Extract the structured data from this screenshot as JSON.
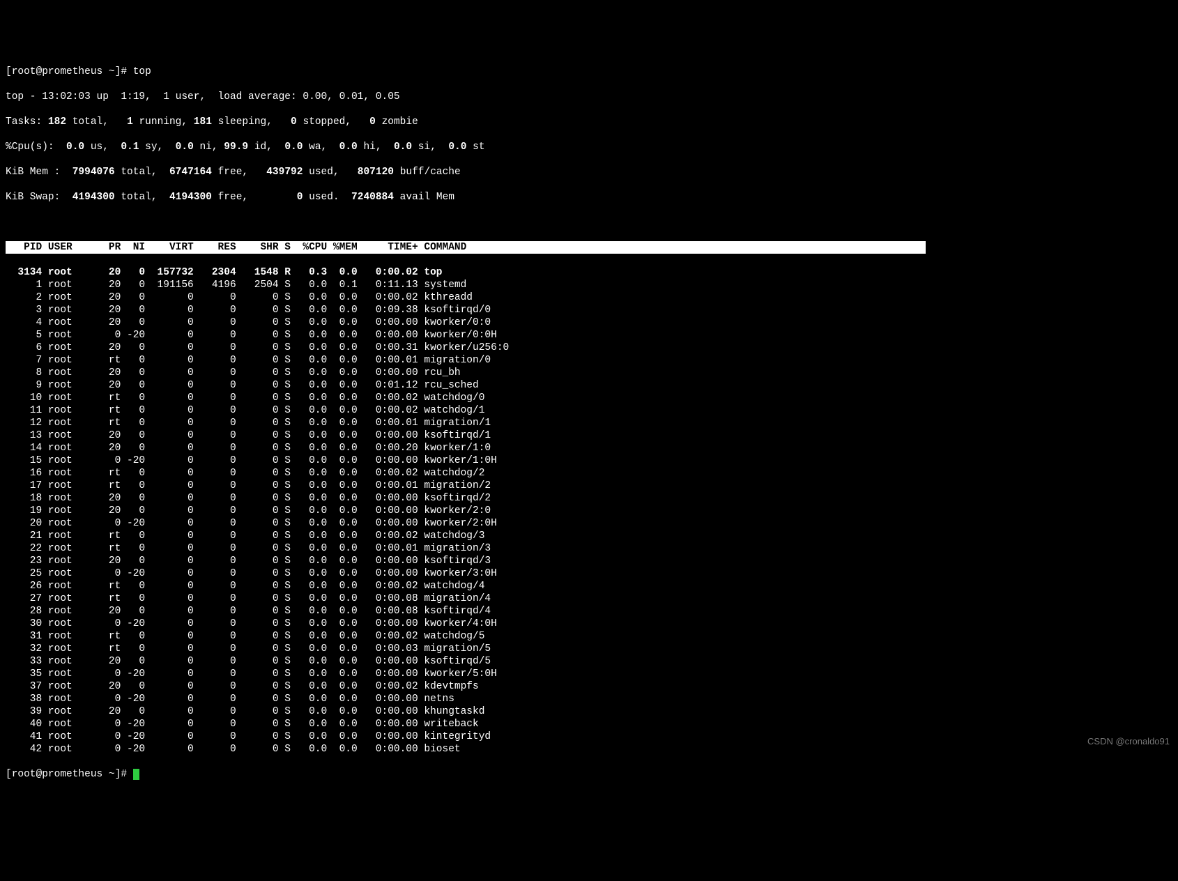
{
  "prompt1": "[root@prometheus ~]# ",
  "command": "top",
  "summary": {
    "line1": "top - 13:02:03 up  1:19,  1 user,  load average: 0.00, 0.01, 0.05",
    "line2_pre": "Tasks: ",
    "line2_total": "182 ",
    "line2_text1": "total,   ",
    "line2_running": "1 ",
    "line2_text2": "running, ",
    "line2_sleeping": "181 ",
    "line2_text3": "sleeping,   ",
    "line2_stopped": "0 ",
    "line2_text4": "stopped,   ",
    "line2_zombie": "0 ",
    "line2_text5": "zombie",
    "line3": "%Cpu(s):  0.0 us,  0.1 sy,  0.0 ni, 99.9 id,  0.0 wa,  0.0 hi,  0.0 si,  0.0 st",
    "line3_pre": "%Cpu(s):  ",
    "cpu_us": "0.0 ",
    "cpu_us_l": "us,  ",
    "cpu_sy": "0.1 ",
    "cpu_sy_l": "sy,  ",
    "cpu_ni": "0.0 ",
    "cpu_ni_l": "ni, ",
    "cpu_id": "99.9 ",
    "cpu_id_l": "id,  ",
    "cpu_wa": "0.0 ",
    "cpu_wa_l": "wa,  ",
    "cpu_hi": "0.0 ",
    "cpu_hi_l": "hi,  ",
    "cpu_si": "0.0 ",
    "cpu_si_l": "si,  ",
    "cpu_st": "0.0 ",
    "cpu_st_l": "st",
    "line4_pre": "KiB Mem : ",
    "mem_total": " 7994076 ",
    "mem_total_l": "total,  ",
    "mem_free": "6747164 ",
    "mem_free_l": "free,   ",
    "mem_used": "439792 ",
    "mem_used_l": "used,   ",
    "mem_buff": "807120 ",
    "mem_buff_l": "buff/cache",
    "line5_pre": "KiB Swap: ",
    "swap_total": " 4194300 ",
    "swap_total_l": "total,  ",
    "swap_free": "4194300 ",
    "swap_free_l": "free,        ",
    "swap_used": "0 ",
    "swap_used_l": "used.  ",
    "swap_avail": "7240884 ",
    "swap_avail_l": "avail Mem"
  },
  "header": "   PID USER      PR  NI    VIRT    RES    SHR S  %CPU %MEM     TIME+ COMMAND",
  "rows": [
    {
      "pid": "3134",
      "user": "root",
      "pr": "20",
      "ni": "0",
      "virt": "157732",
      "res": "2304",
      "shr": "1548",
      "s": "R",
      "cpu": "0.3",
      "mem": "0.0",
      "time": "0:00.02",
      "cmd": "top",
      "bold": true
    },
    {
      "pid": "1",
      "user": "root",
      "pr": "20",
      "ni": "0",
      "virt": "191156",
      "res": "4196",
      "shr": "2504",
      "s": "S",
      "cpu": "0.0",
      "mem": "0.1",
      "time": "0:11.13",
      "cmd": "systemd"
    },
    {
      "pid": "2",
      "user": "root",
      "pr": "20",
      "ni": "0",
      "virt": "0",
      "res": "0",
      "shr": "0",
      "s": "S",
      "cpu": "0.0",
      "mem": "0.0",
      "time": "0:00.02",
      "cmd": "kthreadd"
    },
    {
      "pid": "3",
      "user": "root",
      "pr": "20",
      "ni": "0",
      "virt": "0",
      "res": "0",
      "shr": "0",
      "s": "S",
      "cpu": "0.0",
      "mem": "0.0",
      "time": "0:09.38",
      "cmd": "ksoftirqd/0"
    },
    {
      "pid": "4",
      "user": "root",
      "pr": "20",
      "ni": "0",
      "virt": "0",
      "res": "0",
      "shr": "0",
      "s": "S",
      "cpu": "0.0",
      "mem": "0.0",
      "time": "0:00.00",
      "cmd": "kworker/0:0"
    },
    {
      "pid": "5",
      "user": "root",
      "pr": "0",
      "ni": "-20",
      "virt": "0",
      "res": "0",
      "shr": "0",
      "s": "S",
      "cpu": "0.0",
      "mem": "0.0",
      "time": "0:00.00",
      "cmd": "kworker/0:0H"
    },
    {
      "pid": "6",
      "user": "root",
      "pr": "20",
      "ni": "0",
      "virt": "0",
      "res": "0",
      "shr": "0",
      "s": "S",
      "cpu": "0.0",
      "mem": "0.0",
      "time": "0:00.31",
      "cmd": "kworker/u256:0"
    },
    {
      "pid": "7",
      "user": "root",
      "pr": "rt",
      "ni": "0",
      "virt": "0",
      "res": "0",
      "shr": "0",
      "s": "S",
      "cpu": "0.0",
      "mem": "0.0",
      "time": "0:00.01",
      "cmd": "migration/0"
    },
    {
      "pid": "8",
      "user": "root",
      "pr": "20",
      "ni": "0",
      "virt": "0",
      "res": "0",
      "shr": "0",
      "s": "S",
      "cpu": "0.0",
      "mem": "0.0",
      "time": "0:00.00",
      "cmd": "rcu_bh"
    },
    {
      "pid": "9",
      "user": "root",
      "pr": "20",
      "ni": "0",
      "virt": "0",
      "res": "0",
      "shr": "0",
      "s": "S",
      "cpu": "0.0",
      "mem": "0.0",
      "time": "0:01.12",
      "cmd": "rcu_sched"
    },
    {
      "pid": "10",
      "user": "root",
      "pr": "rt",
      "ni": "0",
      "virt": "0",
      "res": "0",
      "shr": "0",
      "s": "S",
      "cpu": "0.0",
      "mem": "0.0",
      "time": "0:00.02",
      "cmd": "watchdog/0"
    },
    {
      "pid": "11",
      "user": "root",
      "pr": "rt",
      "ni": "0",
      "virt": "0",
      "res": "0",
      "shr": "0",
      "s": "S",
      "cpu": "0.0",
      "mem": "0.0",
      "time": "0:00.02",
      "cmd": "watchdog/1"
    },
    {
      "pid": "12",
      "user": "root",
      "pr": "rt",
      "ni": "0",
      "virt": "0",
      "res": "0",
      "shr": "0",
      "s": "S",
      "cpu": "0.0",
      "mem": "0.0",
      "time": "0:00.01",
      "cmd": "migration/1"
    },
    {
      "pid": "13",
      "user": "root",
      "pr": "20",
      "ni": "0",
      "virt": "0",
      "res": "0",
      "shr": "0",
      "s": "S",
      "cpu": "0.0",
      "mem": "0.0",
      "time": "0:00.00",
      "cmd": "ksoftirqd/1"
    },
    {
      "pid": "14",
      "user": "root",
      "pr": "20",
      "ni": "0",
      "virt": "0",
      "res": "0",
      "shr": "0",
      "s": "S",
      "cpu": "0.0",
      "mem": "0.0",
      "time": "0:00.20",
      "cmd": "kworker/1:0"
    },
    {
      "pid": "15",
      "user": "root",
      "pr": "0",
      "ni": "-20",
      "virt": "0",
      "res": "0",
      "shr": "0",
      "s": "S",
      "cpu": "0.0",
      "mem": "0.0",
      "time": "0:00.00",
      "cmd": "kworker/1:0H"
    },
    {
      "pid": "16",
      "user": "root",
      "pr": "rt",
      "ni": "0",
      "virt": "0",
      "res": "0",
      "shr": "0",
      "s": "S",
      "cpu": "0.0",
      "mem": "0.0",
      "time": "0:00.02",
      "cmd": "watchdog/2"
    },
    {
      "pid": "17",
      "user": "root",
      "pr": "rt",
      "ni": "0",
      "virt": "0",
      "res": "0",
      "shr": "0",
      "s": "S",
      "cpu": "0.0",
      "mem": "0.0",
      "time": "0:00.01",
      "cmd": "migration/2"
    },
    {
      "pid": "18",
      "user": "root",
      "pr": "20",
      "ni": "0",
      "virt": "0",
      "res": "0",
      "shr": "0",
      "s": "S",
      "cpu": "0.0",
      "mem": "0.0",
      "time": "0:00.00",
      "cmd": "ksoftirqd/2"
    },
    {
      "pid": "19",
      "user": "root",
      "pr": "20",
      "ni": "0",
      "virt": "0",
      "res": "0",
      "shr": "0",
      "s": "S",
      "cpu": "0.0",
      "mem": "0.0",
      "time": "0:00.00",
      "cmd": "kworker/2:0"
    },
    {
      "pid": "20",
      "user": "root",
      "pr": "0",
      "ni": "-20",
      "virt": "0",
      "res": "0",
      "shr": "0",
      "s": "S",
      "cpu": "0.0",
      "mem": "0.0",
      "time": "0:00.00",
      "cmd": "kworker/2:0H"
    },
    {
      "pid": "21",
      "user": "root",
      "pr": "rt",
      "ni": "0",
      "virt": "0",
      "res": "0",
      "shr": "0",
      "s": "S",
      "cpu": "0.0",
      "mem": "0.0",
      "time": "0:00.02",
      "cmd": "watchdog/3"
    },
    {
      "pid": "22",
      "user": "root",
      "pr": "rt",
      "ni": "0",
      "virt": "0",
      "res": "0",
      "shr": "0",
      "s": "S",
      "cpu": "0.0",
      "mem": "0.0",
      "time": "0:00.01",
      "cmd": "migration/3"
    },
    {
      "pid": "23",
      "user": "root",
      "pr": "20",
      "ni": "0",
      "virt": "0",
      "res": "0",
      "shr": "0",
      "s": "S",
      "cpu": "0.0",
      "mem": "0.0",
      "time": "0:00.00",
      "cmd": "ksoftirqd/3"
    },
    {
      "pid": "25",
      "user": "root",
      "pr": "0",
      "ni": "-20",
      "virt": "0",
      "res": "0",
      "shr": "0",
      "s": "S",
      "cpu": "0.0",
      "mem": "0.0",
      "time": "0:00.00",
      "cmd": "kworker/3:0H"
    },
    {
      "pid": "26",
      "user": "root",
      "pr": "rt",
      "ni": "0",
      "virt": "0",
      "res": "0",
      "shr": "0",
      "s": "S",
      "cpu": "0.0",
      "mem": "0.0",
      "time": "0:00.02",
      "cmd": "watchdog/4"
    },
    {
      "pid": "27",
      "user": "root",
      "pr": "rt",
      "ni": "0",
      "virt": "0",
      "res": "0",
      "shr": "0",
      "s": "S",
      "cpu": "0.0",
      "mem": "0.0",
      "time": "0:00.08",
      "cmd": "migration/4"
    },
    {
      "pid": "28",
      "user": "root",
      "pr": "20",
      "ni": "0",
      "virt": "0",
      "res": "0",
      "shr": "0",
      "s": "S",
      "cpu": "0.0",
      "mem": "0.0",
      "time": "0:00.08",
      "cmd": "ksoftirqd/4"
    },
    {
      "pid": "30",
      "user": "root",
      "pr": "0",
      "ni": "-20",
      "virt": "0",
      "res": "0",
      "shr": "0",
      "s": "S",
      "cpu": "0.0",
      "mem": "0.0",
      "time": "0:00.00",
      "cmd": "kworker/4:0H"
    },
    {
      "pid": "31",
      "user": "root",
      "pr": "rt",
      "ni": "0",
      "virt": "0",
      "res": "0",
      "shr": "0",
      "s": "S",
      "cpu": "0.0",
      "mem": "0.0",
      "time": "0:00.02",
      "cmd": "watchdog/5"
    },
    {
      "pid": "32",
      "user": "root",
      "pr": "rt",
      "ni": "0",
      "virt": "0",
      "res": "0",
      "shr": "0",
      "s": "S",
      "cpu": "0.0",
      "mem": "0.0",
      "time": "0:00.03",
      "cmd": "migration/5"
    },
    {
      "pid": "33",
      "user": "root",
      "pr": "20",
      "ni": "0",
      "virt": "0",
      "res": "0",
      "shr": "0",
      "s": "S",
      "cpu": "0.0",
      "mem": "0.0",
      "time": "0:00.00",
      "cmd": "ksoftirqd/5"
    },
    {
      "pid": "35",
      "user": "root",
      "pr": "0",
      "ni": "-20",
      "virt": "0",
      "res": "0",
      "shr": "0",
      "s": "S",
      "cpu": "0.0",
      "mem": "0.0",
      "time": "0:00.00",
      "cmd": "kworker/5:0H"
    },
    {
      "pid": "37",
      "user": "root",
      "pr": "20",
      "ni": "0",
      "virt": "0",
      "res": "0",
      "shr": "0",
      "s": "S",
      "cpu": "0.0",
      "mem": "0.0",
      "time": "0:00.02",
      "cmd": "kdevtmpfs"
    },
    {
      "pid": "38",
      "user": "root",
      "pr": "0",
      "ni": "-20",
      "virt": "0",
      "res": "0",
      "shr": "0",
      "s": "S",
      "cpu": "0.0",
      "mem": "0.0",
      "time": "0:00.00",
      "cmd": "netns"
    },
    {
      "pid": "39",
      "user": "root",
      "pr": "20",
      "ni": "0",
      "virt": "0",
      "res": "0",
      "shr": "0",
      "s": "S",
      "cpu": "0.0",
      "mem": "0.0",
      "time": "0:00.00",
      "cmd": "khungtaskd"
    },
    {
      "pid": "40",
      "user": "root",
      "pr": "0",
      "ni": "-20",
      "virt": "0",
      "res": "0",
      "shr": "0",
      "s": "S",
      "cpu": "0.0",
      "mem": "0.0",
      "time": "0:00.00",
      "cmd": "writeback"
    },
    {
      "pid": "41",
      "user": "root",
      "pr": "0",
      "ni": "-20",
      "virt": "0",
      "res": "0",
      "shr": "0",
      "s": "S",
      "cpu": "0.0",
      "mem": "0.0",
      "time": "0:00.00",
      "cmd": "kintegrityd"
    },
    {
      "pid": "42",
      "user": "root",
      "pr": "0",
      "ni": "-20",
      "virt": "0",
      "res": "0",
      "shr": "0",
      "s": "S",
      "cpu": "0.0",
      "mem": "0.0",
      "time": "0:00.00",
      "cmd": "bioset"
    }
  ],
  "prompt2": "[root@prometheus ~]# ",
  "watermark": "CSDN @cronaldo91"
}
